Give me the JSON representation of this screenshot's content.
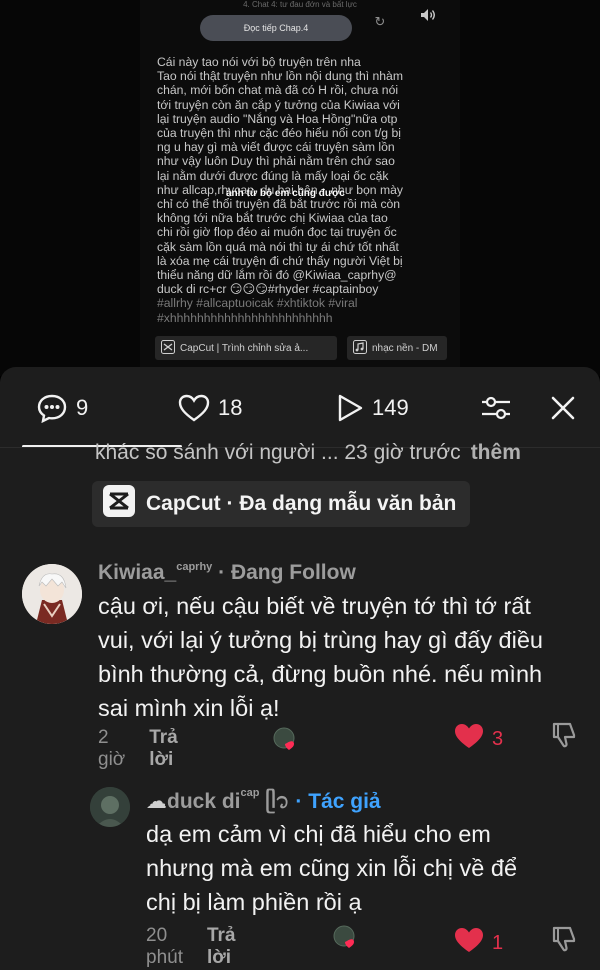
{
  "video": {
    "top_text": "4. Chat 4: tư đau đớn và bất lực",
    "continue_button": "Đọc tiếp Chap.4",
    "caption_lines": [
      "Cái này tao nói với bộ truyện trên nha",
      "Tao nói thật truyện như lồn nội dung thì nhàm",
      "chán, mới bốn chat mà đã có H rồi, chưa nói",
      "tới truyện còn ăn cắp ý tưởng của Kiwiaa với",
      "lại truyện audio \"Nắng và Hoa Hồng\"nữa otp",
      "của truyện thì như cặc đéo hiểu nổi con t/g bị",
      "ng u hay gì mà viết được cái truyện sàm lồn",
      "như vậy luôn Duy thì phải nằm trên chứ sao",
      "lại nằm dưới được đúng là mấy loại ốc cặk",
      "như allcap,rhycap, du bai bên... như bọn mày",
      "chỉ có thể thổi truyện đã bắt trước rồi mà còn",
      "không tới nữa bắt trước chị Kiwiaa của tao",
      "chi rồi giờ flop đéo ai muốn đọc tại truyện ốc",
      "cặk sàm lồn quá mà nói thì tự ái chứ tốt nhất",
      "là xóa mẹ cái truyện đi chứ thấy người Việt bị",
      "thiểu năng dữ lắm rồi đó @Kiwiaa_caprhy@",
      "duck di rc+cr 😏😏😏#rhyder #captainboy"
    ],
    "tag_lines": [
      "#allrhy #allcaptuoicak #xhtiktok #viral",
      "#xhhhhhhhhhhhhhhhhhhhhhhhh"
    ],
    "overlay_text": "ảnh từ bộ em cũng được",
    "link_capcut": "CapCut | Trình chỉnh sửa ả...",
    "link_music": "nhạc nền - DM"
  },
  "toolbar": {
    "comments_count": "9",
    "likes_count": "18",
    "views_count": "149"
  },
  "previous_comment": {
    "text": "khác so sánh với người ... 23 giờ trước",
    "more": "thêm"
  },
  "capcut_chip": {
    "label": "CapCut · Đa dạng mẫu văn bản"
  },
  "comments": [
    {
      "username": "Kiwiaa_",
      "username_sup": "caprhy",
      "badge": " · Đang Follow",
      "lines": [
        "cậu ơi, nếu cậu biết về truyện tớ thì tớ rất",
        "vui, với lại ý tưởng bị trùng hay gì đấy điều",
        "bình thường cả, đừng buồn nhé. nếu mình",
        "sai mình xin lỗi ạ!"
      ],
      "time": "2 giờ",
      "reply": "Trả lời",
      "likes": "3"
    },
    {
      "username": "duck di",
      "username_sup": "cap",
      "username_tail": " ᥫ᭡",
      "badge": " · Tác giả",
      "lines": [
        "dạ em cảm vì chị đã hiểu cho em",
        "nhưng mà em cũng xin lỗi chị về để",
        "chị bị làm phiền rồi ạ"
      ],
      "time": "20 phút",
      "reply": "Trả lời",
      "likes": "1"
    }
  ],
  "colors": {
    "sheet_bg": "#1d1d1d",
    "like_red": "#e3304c",
    "author_blue": "#3fa3ff"
  }
}
